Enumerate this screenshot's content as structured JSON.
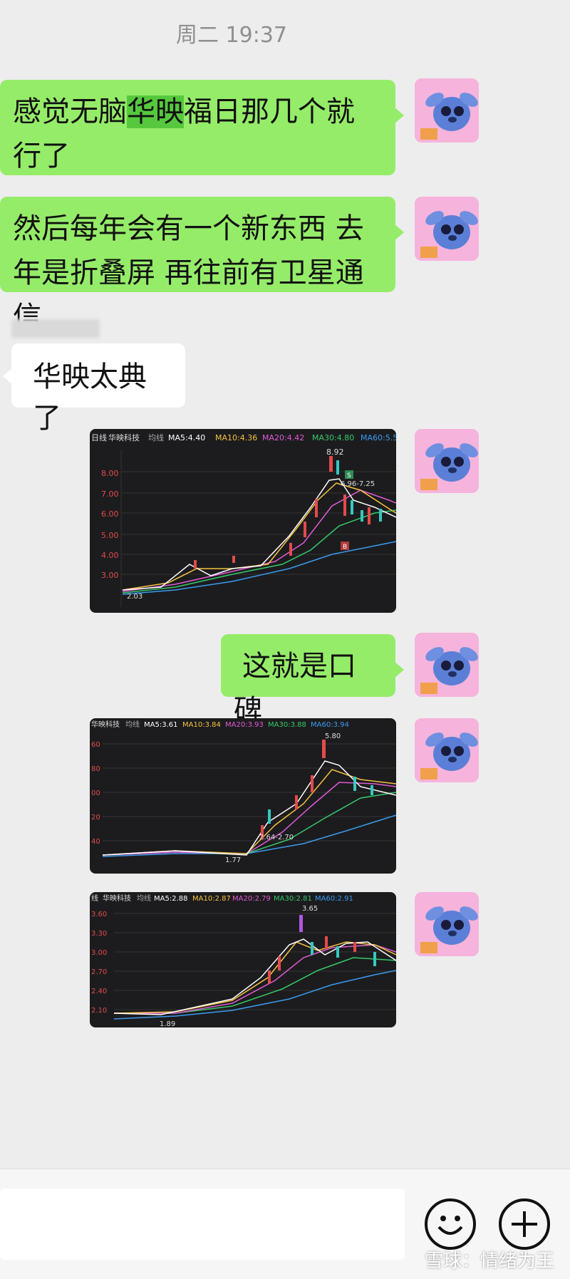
{
  "header": {
    "time": "周二 19:37"
  },
  "messages": [
    {
      "from": "me",
      "text_parts": [
        "感觉无脑",
        "华映",
        "福日那几个就行了"
      ]
    },
    {
      "from": "me",
      "text": "然后每年会有一个新东西 去年是折叠屏 再往前有卫星通信"
    },
    {
      "from": "other",
      "text": "华映太典了"
    },
    {
      "from": "me",
      "text": "这就是口碑"
    }
  ],
  "charts": [
    {
      "legend": [
        "日线",
        "华映科技",
        "均线",
        "MA5:4.40",
        "MA10:4.36",
        "MA20:4.42",
        "MA30:4.80",
        "MA60:5.5"
      ],
      "legend_colors": [
        "#dddddd",
        "#dddddd",
        "#aaaaaa",
        "#ffffff",
        "#f5c242",
        "#e05ad4",
        "#35c96a",
        "#3a9bf0"
      ],
      "y_ticks": [
        "8.00",
        "7.00",
        "6.00",
        "5.00",
        "4.00",
        "3.00"
      ],
      "annotations": {
        "high": "8.92",
        "low": "2.03",
        "range": "6.96-7.25",
        "sell": "S",
        "buy": "B"
      }
    },
    {
      "legend": [
        "华映科技",
        "均线",
        "MA5:3.61",
        "MA10:3.84",
        "MA20:3.93",
        "MA30:3.88",
        "MA60:3.94"
      ],
      "legend_colors": [
        "#dddddd",
        "#aaaaaa",
        "#ffffff",
        "#f5c242",
        "#e05ad4",
        "#35c96a",
        "#3a9bf0"
      ],
      "y_ticks": [
        "60",
        "80",
        "00",
        "20",
        "40"
      ],
      "annotations": {
        "high": "5.80",
        "low": "1.77",
        "range": "2.64-2.70"
      }
    },
    {
      "legend": [
        "线",
        "华映科技",
        "均线",
        "MA5:2.88",
        "MA10:2.87",
        "MA20:2.79",
        "MA30:2.81",
        "MA60:2.91"
      ],
      "legend_colors": [
        "#dddddd",
        "#dddddd",
        "#aaaaaa",
        "#ffffff",
        "#f5c242",
        "#e05ad4",
        "#35c96a",
        "#3a9bf0"
      ],
      "y_ticks": [
        "3.60",
        "3.30",
        "3.00",
        "2.70",
        "2.40",
        "2.10"
      ],
      "annotations": {
        "high": "3.65",
        "low": "1.89"
      }
    }
  ],
  "input": {
    "emoji_icon": "smiley-icon",
    "plus_icon": "plus-icon"
  },
  "watermark": "雪球：情绪为王"
}
